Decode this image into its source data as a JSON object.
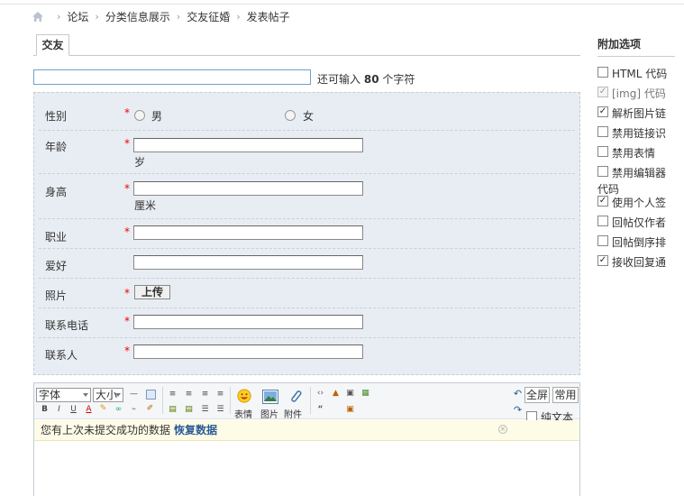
{
  "breadcrumb": {
    "items": [
      "论坛",
      "分类信息展示",
      "交友征婚",
      "发表帖子"
    ],
    "separator": "›"
  },
  "tabs": [
    {
      "label": "交友",
      "active": true
    }
  ],
  "subject": {
    "value": "",
    "hint_prefix": "还可输入",
    "hint_count": "80",
    "hint_suffix": "个字符"
  },
  "form": {
    "gender": {
      "label": "性别",
      "required": "*",
      "options": [
        "男",
        "女"
      ]
    },
    "age": {
      "label": "年龄",
      "required": "*",
      "unit": "岁"
    },
    "height": {
      "label": "身高",
      "required": "*",
      "unit": "厘米"
    },
    "job": {
      "label": "职业",
      "required": "*"
    },
    "hobby": {
      "label": "爱好"
    },
    "photo": {
      "label": "照片",
      "required": "*",
      "button": "上传"
    },
    "phone": {
      "label": "联系电话",
      "required": "*"
    },
    "contact": {
      "label": "联系人",
      "required": "*"
    }
  },
  "editor": {
    "font_select": "字体",
    "size_select": "大小",
    "emoticon_label": "表情",
    "image_label": "图片",
    "attach_label": "附件",
    "fullscreen_label": "全屏",
    "common_label": "常用",
    "plaintext_label": "纯文本",
    "notice_text": "您有上次未提交成功的数据",
    "notice_link": "恢复数据"
  },
  "side": {
    "title": "附加选项",
    "options": [
      {
        "label": "HTML 代码",
        "checked": false,
        "disabled": false
      },
      {
        "label": "[img] 代码",
        "checked": true,
        "disabled": true
      },
      {
        "label": "解析图片链",
        "checked": true,
        "disabled": false
      },
      {
        "label": "禁用链接识",
        "checked": false,
        "disabled": false
      },
      {
        "label": "禁用表情",
        "checked": false,
        "disabled": false
      },
      {
        "label": "禁用编辑器",
        "checked": false,
        "disabled": false
      },
      {
        "label": "代码",
        "checked": false,
        "disabled": false
      },
      {
        "label": "使用个人签",
        "checked": true,
        "disabled": false
      },
      {
        "label": "回帖仅作者",
        "checked": false,
        "disabled": false
      },
      {
        "label": "回帖倒序排",
        "checked": false,
        "disabled": false
      },
      {
        "label": "接收回复通",
        "checked": true,
        "disabled": false
      }
    ]
  },
  "colors": {
    "panel_bg": "#e8edf3",
    "required": "#ee0000",
    "link": "#2a5c97",
    "notice_bg": "#fefbe6"
  }
}
